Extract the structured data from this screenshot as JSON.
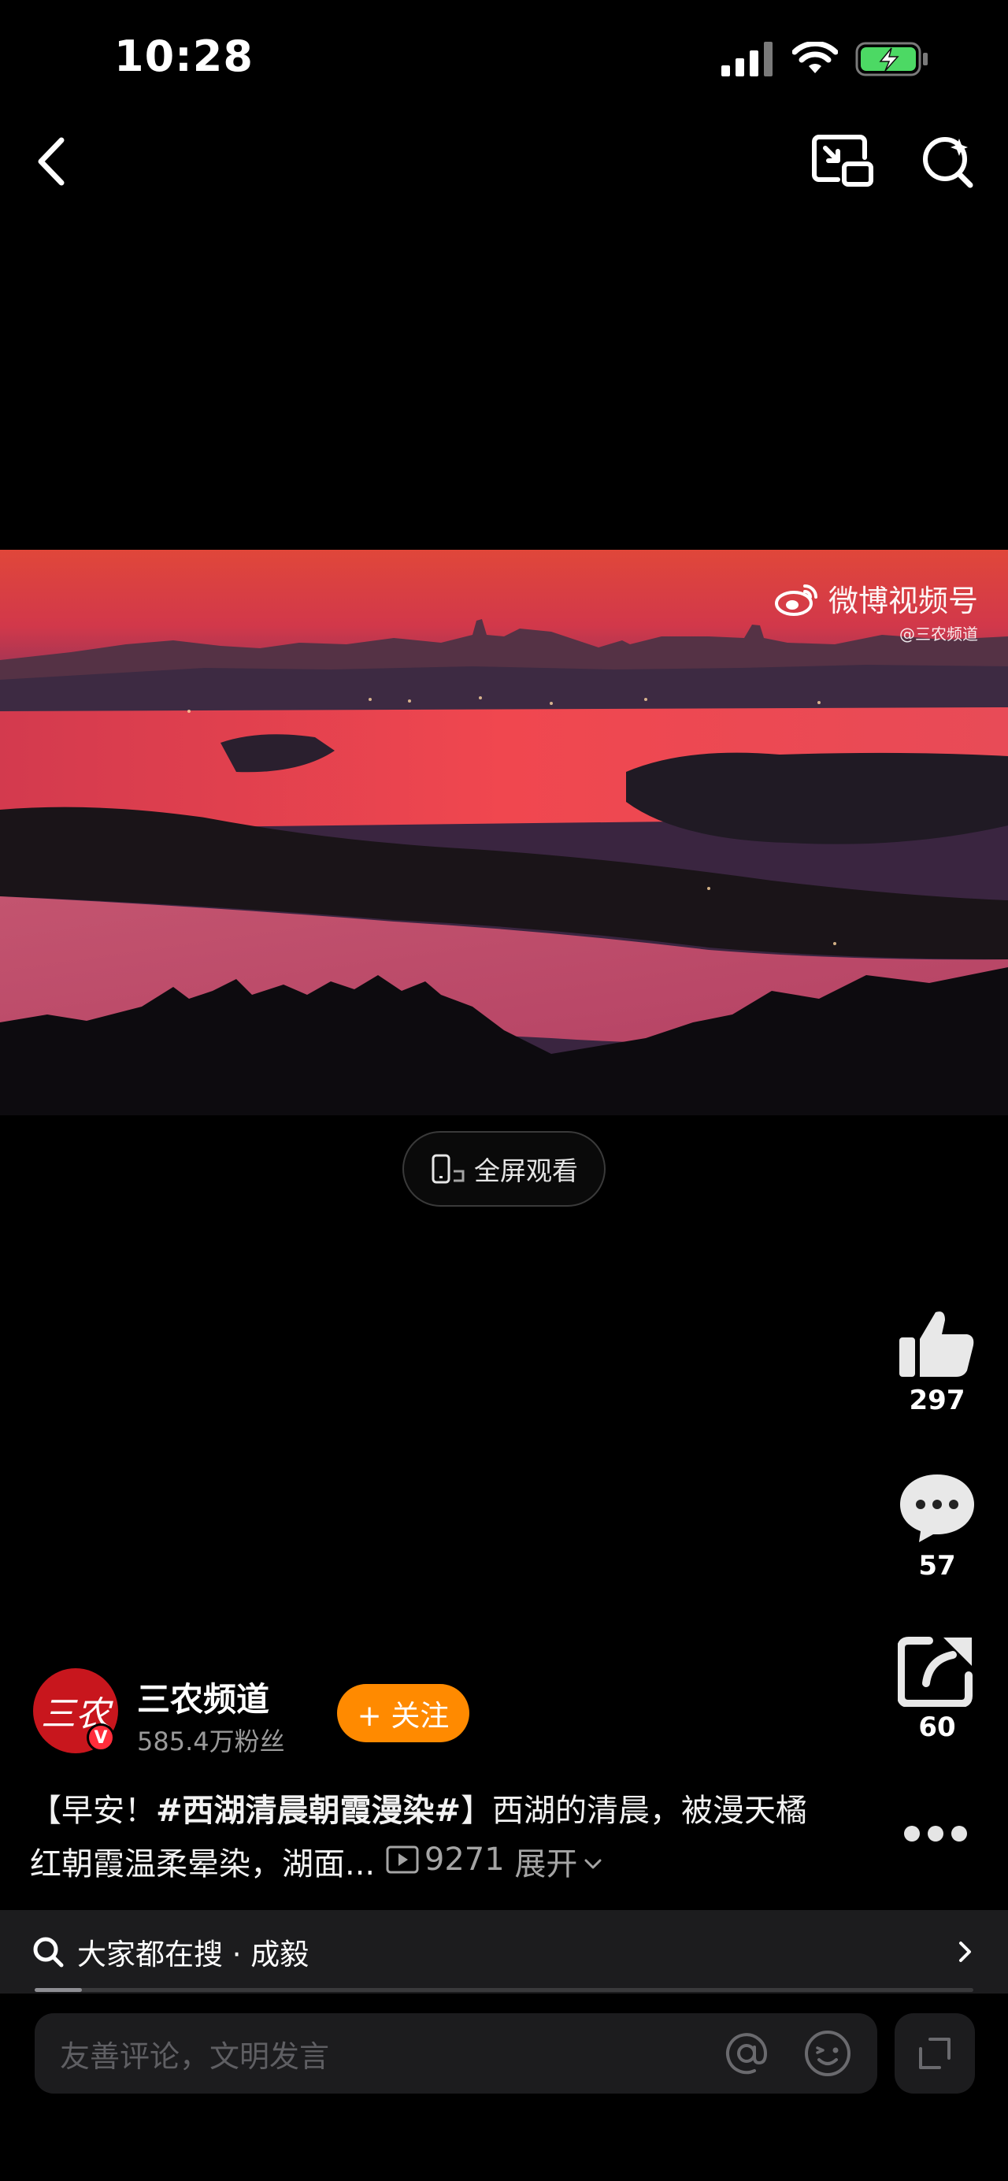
{
  "status_bar": {
    "time": "10:28"
  },
  "video": {
    "watermark_title": "微博视频号",
    "watermark_handle": "@三农频道",
    "fullscreen_label": "全屏观看"
  },
  "actions": {
    "like_count": "297",
    "comment_count": "57",
    "share_count": "60"
  },
  "author": {
    "avatar_text": "三农",
    "verified_badge": "V",
    "name": "三农频道",
    "fans": "585.4万粉丝",
    "follow_label": "+ 关注"
  },
  "caption": {
    "prefix": "【早安！",
    "hashtag": "#西湖清晨朝霞漫染#",
    "suffix": "】西湖的清晨，被漫天橘红朝霞温柔晕染，湖面...",
    "views": "9271",
    "expand_label": "展开"
  },
  "search": {
    "label": "大家都在搜 · 成毅",
    "progress": 0.05
  },
  "comment": {
    "placeholder": "友善评论，文明发言"
  },
  "colors": {
    "follow": "#ff8a00",
    "badge": "#ff2d3b",
    "avatar": "#c8161d",
    "battery": "#4cd964"
  },
  "icons": [
    "back-icon",
    "pip-icon",
    "search-icon",
    "like-icon",
    "comment-icon",
    "share-icon",
    "more-icon",
    "at-icon",
    "emoji-icon",
    "expand-icon",
    "chevron-right-icon",
    "play-icon",
    "phone-icon",
    "weibo-icon"
  ]
}
